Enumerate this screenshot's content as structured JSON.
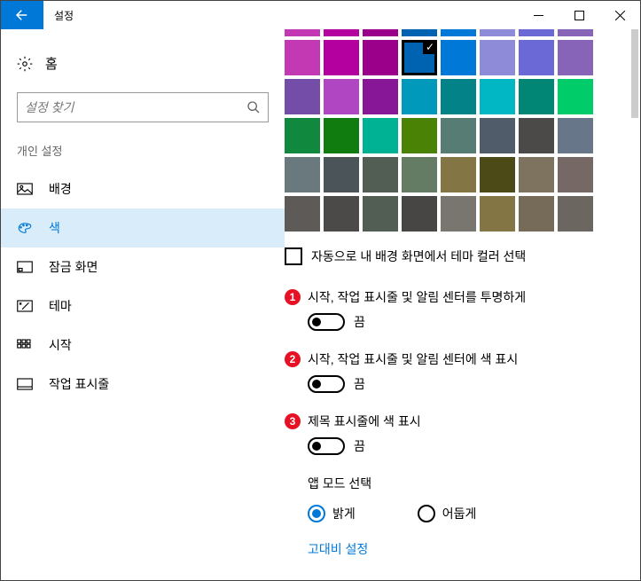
{
  "titlebar": {
    "title": "설정"
  },
  "sidebar": {
    "home": "홈",
    "search_placeholder": "설정 찾기",
    "category": "개인 설정",
    "items": [
      {
        "label": "배경"
      },
      {
        "label": "색"
      },
      {
        "label": "잠금 화면"
      },
      {
        "label": "테마"
      },
      {
        "label": "시작"
      },
      {
        "label": "작업 표시줄"
      }
    ]
  },
  "colors": {
    "rows": [
      [
        "#c239b3",
        "#b4009e",
        "#9a0089",
        "#0063b1",
        "#0078d7",
        "#8e8cd8",
        "#6b69d6",
        "#8764b8"
      ],
      [
        "#744da9",
        "#b146c2",
        "#881798",
        "#0099bc",
        "#038387",
        "#00b7c3",
        "#018574",
        "#00cc6a"
      ],
      [
        "#10893e",
        "#107c10",
        "#00b294",
        "#498205",
        "#567c73",
        "#515c6b",
        "#4c4a48",
        "#68768a"
      ],
      [
        "#69797e",
        "#4a5459",
        "#525e54",
        "#647c64",
        "#847545",
        "#4c4a16",
        "#7e735f",
        "#766965"
      ],
      [
        "#5d5a58",
        "#4c4a48",
        "#525e54",
        "#484644",
        "#797670",
        "#847545",
        "#766b59",
        "#6b6760"
      ]
    ],
    "selected_row": 0,
    "selected_col": 3
  },
  "auto_checkbox": {
    "label": "자동으로 내 배경 화면에서 테마 컬러 선택"
  },
  "toggles": [
    {
      "badge": "1",
      "label": "시작, 작업 표시줄 및 알림 센터를 투명하게",
      "state": "끔"
    },
    {
      "badge": "2",
      "label": "시작, 작업 표시줄 및 알림 센터에 색 표시",
      "state": "끔"
    },
    {
      "badge": "3",
      "label": "제목 표시줄에 색 표시",
      "state": "끔"
    }
  ],
  "mode": {
    "label": "앱 모드 선택",
    "options": [
      "밝게",
      "어둡게"
    ],
    "selected": 0
  },
  "link": "고대비 설정"
}
